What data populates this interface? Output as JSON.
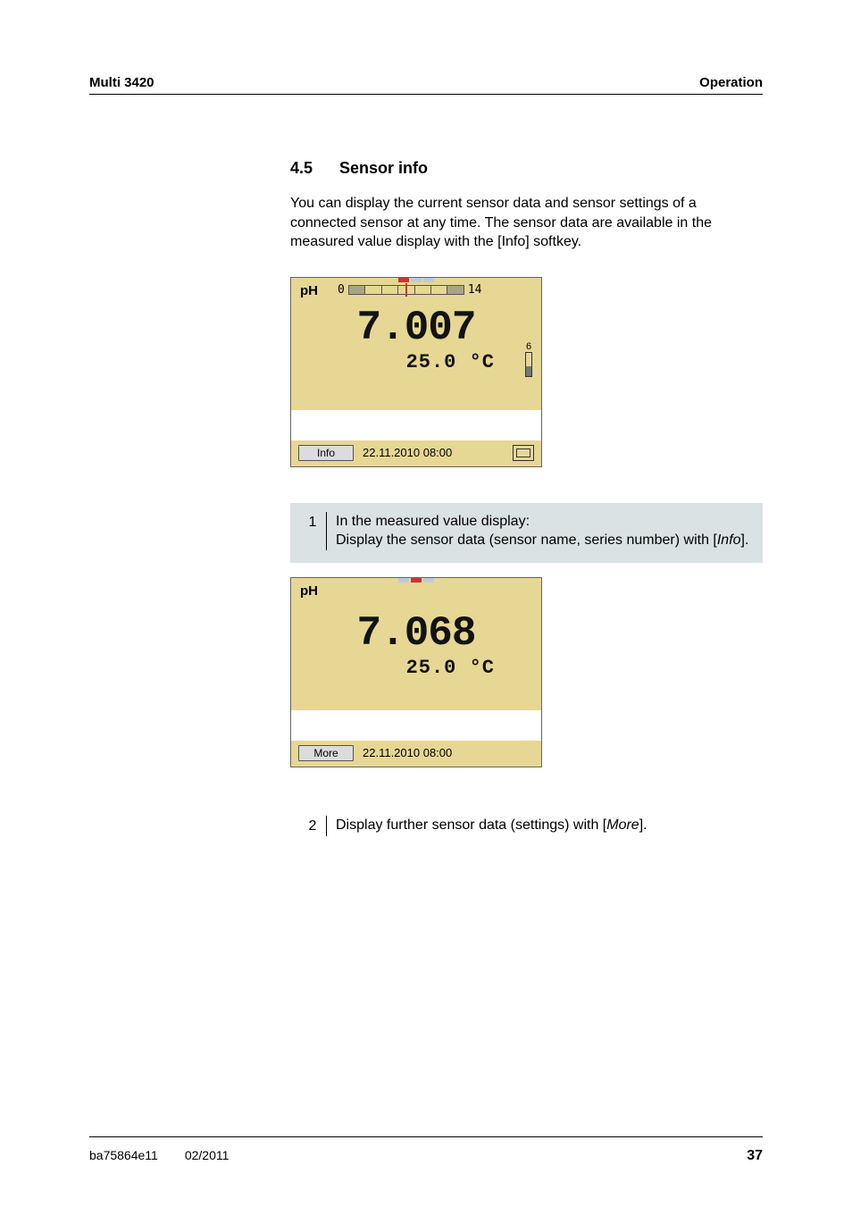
{
  "header": {
    "left": "Multi 3420",
    "right": "Operation"
  },
  "section": {
    "number": "4.5",
    "title": "Sensor info"
  },
  "intro": "You can display the current sensor data and sensor settings of a connected sensor at any time. The sensor data are available in the measured value display with the [Info] softkey.",
  "screen1": {
    "label": "pH",
    "scale_min": "0",
    "scale_max": "14",
    "value": "7.007",
    "temp": "25.0 °C",
    "softkey": "Info",
    "timestamp": "22.11.2010 08:00"
  },
  "step1": {
    "num": "1",
    "line1": "In the measured value display:",
    "line2a": "Display the sensor data (sensor name, series number) with [",
    "line2_ital": "Info",
    "line2b": "]."
  },
  "screen2": {
    "label": "pH",
    "value": "7.068",
    "temp": "25.0 °C",
    "softkey": "More",
    "timestamp": "22.11.2010 08:00"
  },
  "step2": {
    "num": "2",
    "text_a": "Display further sensor data (settings) with [",
    "text_ital": "More",
    "text_b": "]."
  },
  "footer": {
    "docid": "ba75864e11",
    "date": "02/2011",
    "page": "37"
  }
}
